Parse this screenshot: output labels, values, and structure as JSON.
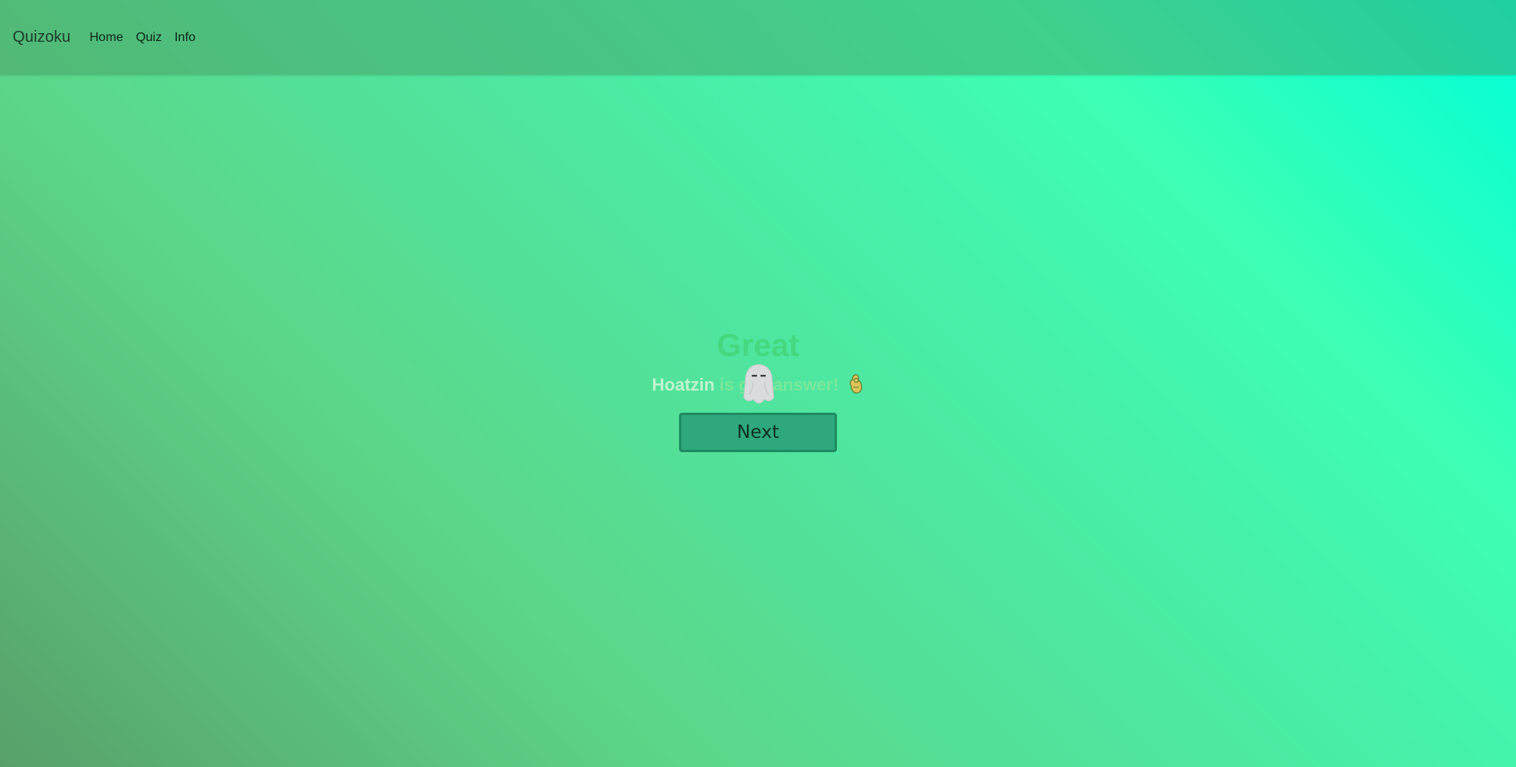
{
  "navbar": {
    "brand": "Quizoku",
    "links": [
      "Home",
      "Quiz",
      "Info"
    ]
  },
  "result": {
    "title": "Great",
    "answer_name": "Hoatzin",
    "message_before": "is g",
    "message_after": " answer!"
  },
  "next_button": {
    "label": "Next"
  },
  "icons": {
    "ghost": "ghost-icon",
    "ok_hand": "ok-hand-icon"
  },
  "colors": {
    "gradient_top_right": "#00ffd8",
    "gradient_bottom_left": "#58a06a",
    "title": "#45d87e",
    "button": "#2ea87c"
  }
}
